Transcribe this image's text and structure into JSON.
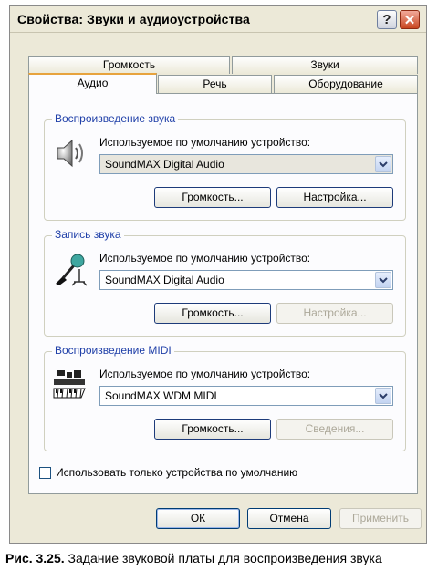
{
  "window": {
    "title": "Свойства: Звуки и аудиоустройства",
    "help_symbol": "?",
    "close_symbol": "✕"
  },
  "tabs": {
    "row_top": [
      "Громкость",
      "Звуки"
    ],
    "row_bottom": [
      "Аудио",
      "Речь",
      "Оборудование"
    ],
    "active": "Аудио"
  },
  "groups": [
    {
      "title": "Воспроизведение звука",
      "icon": "speaker-icon",
      "device_label": "Используемое по умолчанию устройство:",
      "device_value": "SoundMAX Digital Audio",
      "volume_button": "Громкость...",
      "settings_button": "Настройка...",
      "settings_enabled": true
    },
    {
      "title": "Запись звука",
      "icon": "microphone-icon",
      "device_label": "Используемое по умолчанию устройство:",
      "device_value": "SoundMAX Digital Audio",
      "volume_button": "Громкость...",
      "settings_button": "Настройка...",
      "settings_enabled": false
    },
    {
      "title": "Воспроизведение MIDI",
      "icon": "midi-keyboard-icon",
      "device_label": "Используемое по умолчанию устройство:",
      "device_value": "SoundMAX WDM MIDI",
      "volume_button": "Громкость...",
      "settings_button": "Сведения...",
      "settings_enabled": false
    }
  ],
  "checkbox": {
    "label": "Использовать только устройства по умолчанию",
    "checked": false
  },
  "footer": {
    "ok": "ОК",
    "cancel": "Отмена",
    "apply": "Применить"
  },
  "caption": {
    "bold": "Рис. 3.25.",
    "text": " Задание звуковой платы для воспроизведения звука"
  },
  "colors": {
    "dialog_bg": "#ece9d8",
    "group_title": "#1f3fa8",
    "active_tab_highlight": "#e7a33d"
  }
}
